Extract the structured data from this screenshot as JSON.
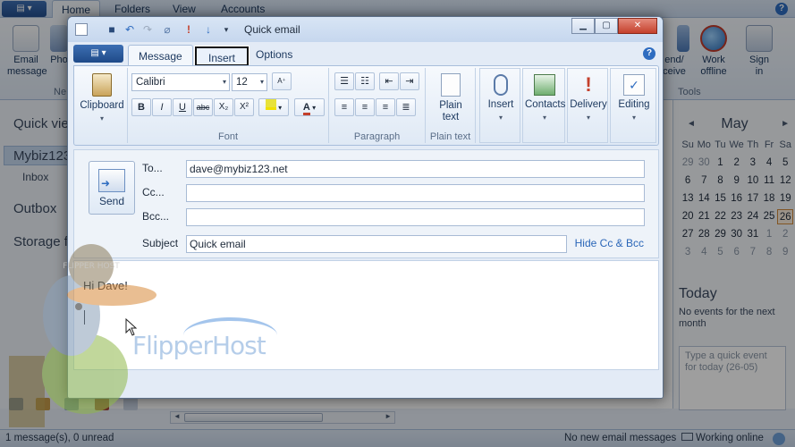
{
  "main": {
    "tabs": [
      "Home",
      "Folders",
      "View",
      "Accounts"
    ],
    "ribbon_buttons": [
      {
        "label": "Email\nmessage",
        "icon": "email-message-icon"
      },
      {
        "label": "Pho",
        "icon": "photo-icon"
      },
      {
        "label": "end/\nceive",
        "icon": "send-receive-icon"
      },
      {
        "label": "Work\noffline",
        "icon": "work-offline-icon"
      },
      {
        "label": "Sign\nin",
        "icon": "sign-in-icon"
      }
    ],
    "group_captions": {
      "left": "Ne",
      "tools": "Tools"
    },
    "nav": {
      "quick_views": "Quick vie",
      "account": "Mybiz123",
      "inbox": "Inbox",
      "outbox": "Outbox",
      "storage": "Storage f"
    },
    "calendar": {
      "month": "May",
      "prev": "◄",
      "next": "►",
      "day_headers": [
        "Su",
        "Mo",
        "Tu",
        "We",
        "Th",
        "Fr",
        "Sa"
      ],
      "weeks": [
        [
          "29",
          "30",
          "1",
          "2",
          "3",
          "4",
          "5"
        ],
        [
          "6",
          "7",
          "8",
          "9",
          "10",
          "11",
          "12"
        ],
        [
          "13",
          "14",
          "15",
          "16",
          "17",
          "18",
          "19"
        ],
        [
          "20",
          "21",
          "22",
          "23",
          "24",
          "25",
          "26"
        ],
        [
          "27",
          "28",
          "29",
          "30",
          "31",
          "1",
          "2"
        ],
        [
          "3",
          "4",
          "5",
          "6",
          "7",
          "8",
          "9"
        ]
      ],
      "today_date": "26"
    },
    "today": {
      "title": "Today",
      "no_events": "No events for the next month",
      "quick_event_placeholder": "Type a quick event for today (26-05)"
    },
    "status": {
      "messages": "1 message(s), 0 unread",
      "new_email": "No new email messages",
      "online": "Working online"
    }
  },
  "watermark": {
    "brand": "FlipperHost",
    "badge": "FLIPPER HOST"
  },
  "compose": {
    "title": "Quick email",
    "tabs": {
      "message": "Message",
      "insert": "Insert",
      "options": "Options"
    },
    "ribbon": {
      "clipboard": "Clipboard",
      "font_name": "Calibri",
      "font_size": "12",
      "font_group": "Font",
      "paragraph_group": "Paragraph",
      "plain_text": "Plain\ntext",
      "plain_text_group": "Plain text",
      "insert": "Insert",
      "contacts": "Contacts",
      "delivery": "Delivery",
      "editing": "Editing",
      "bold": "B",
      "italic": "I",
      "underline": "U",
      "strike": "abc",
      "subscript": "X₂",
      "superscript": "X²"
    },
    "header": {
      "send": "Send",
      "to_label": "To...",
      "to_value": "dave@mybiz123.net",
      "cc_label": "Cc...",
      "bcc_label": "Bcc...",
      "subject_label": "Subject",
      "subject_value": "Quick email",
      "hide_cc_bcc": "Hide Cc & Bcc"
    },
    "body_text": "Hi Dave!"
  },
  "colors": {
    "accent": "#2e6cc0",
    "close": "#c4402c",
    "link": "#2a66b8"
  }
}
